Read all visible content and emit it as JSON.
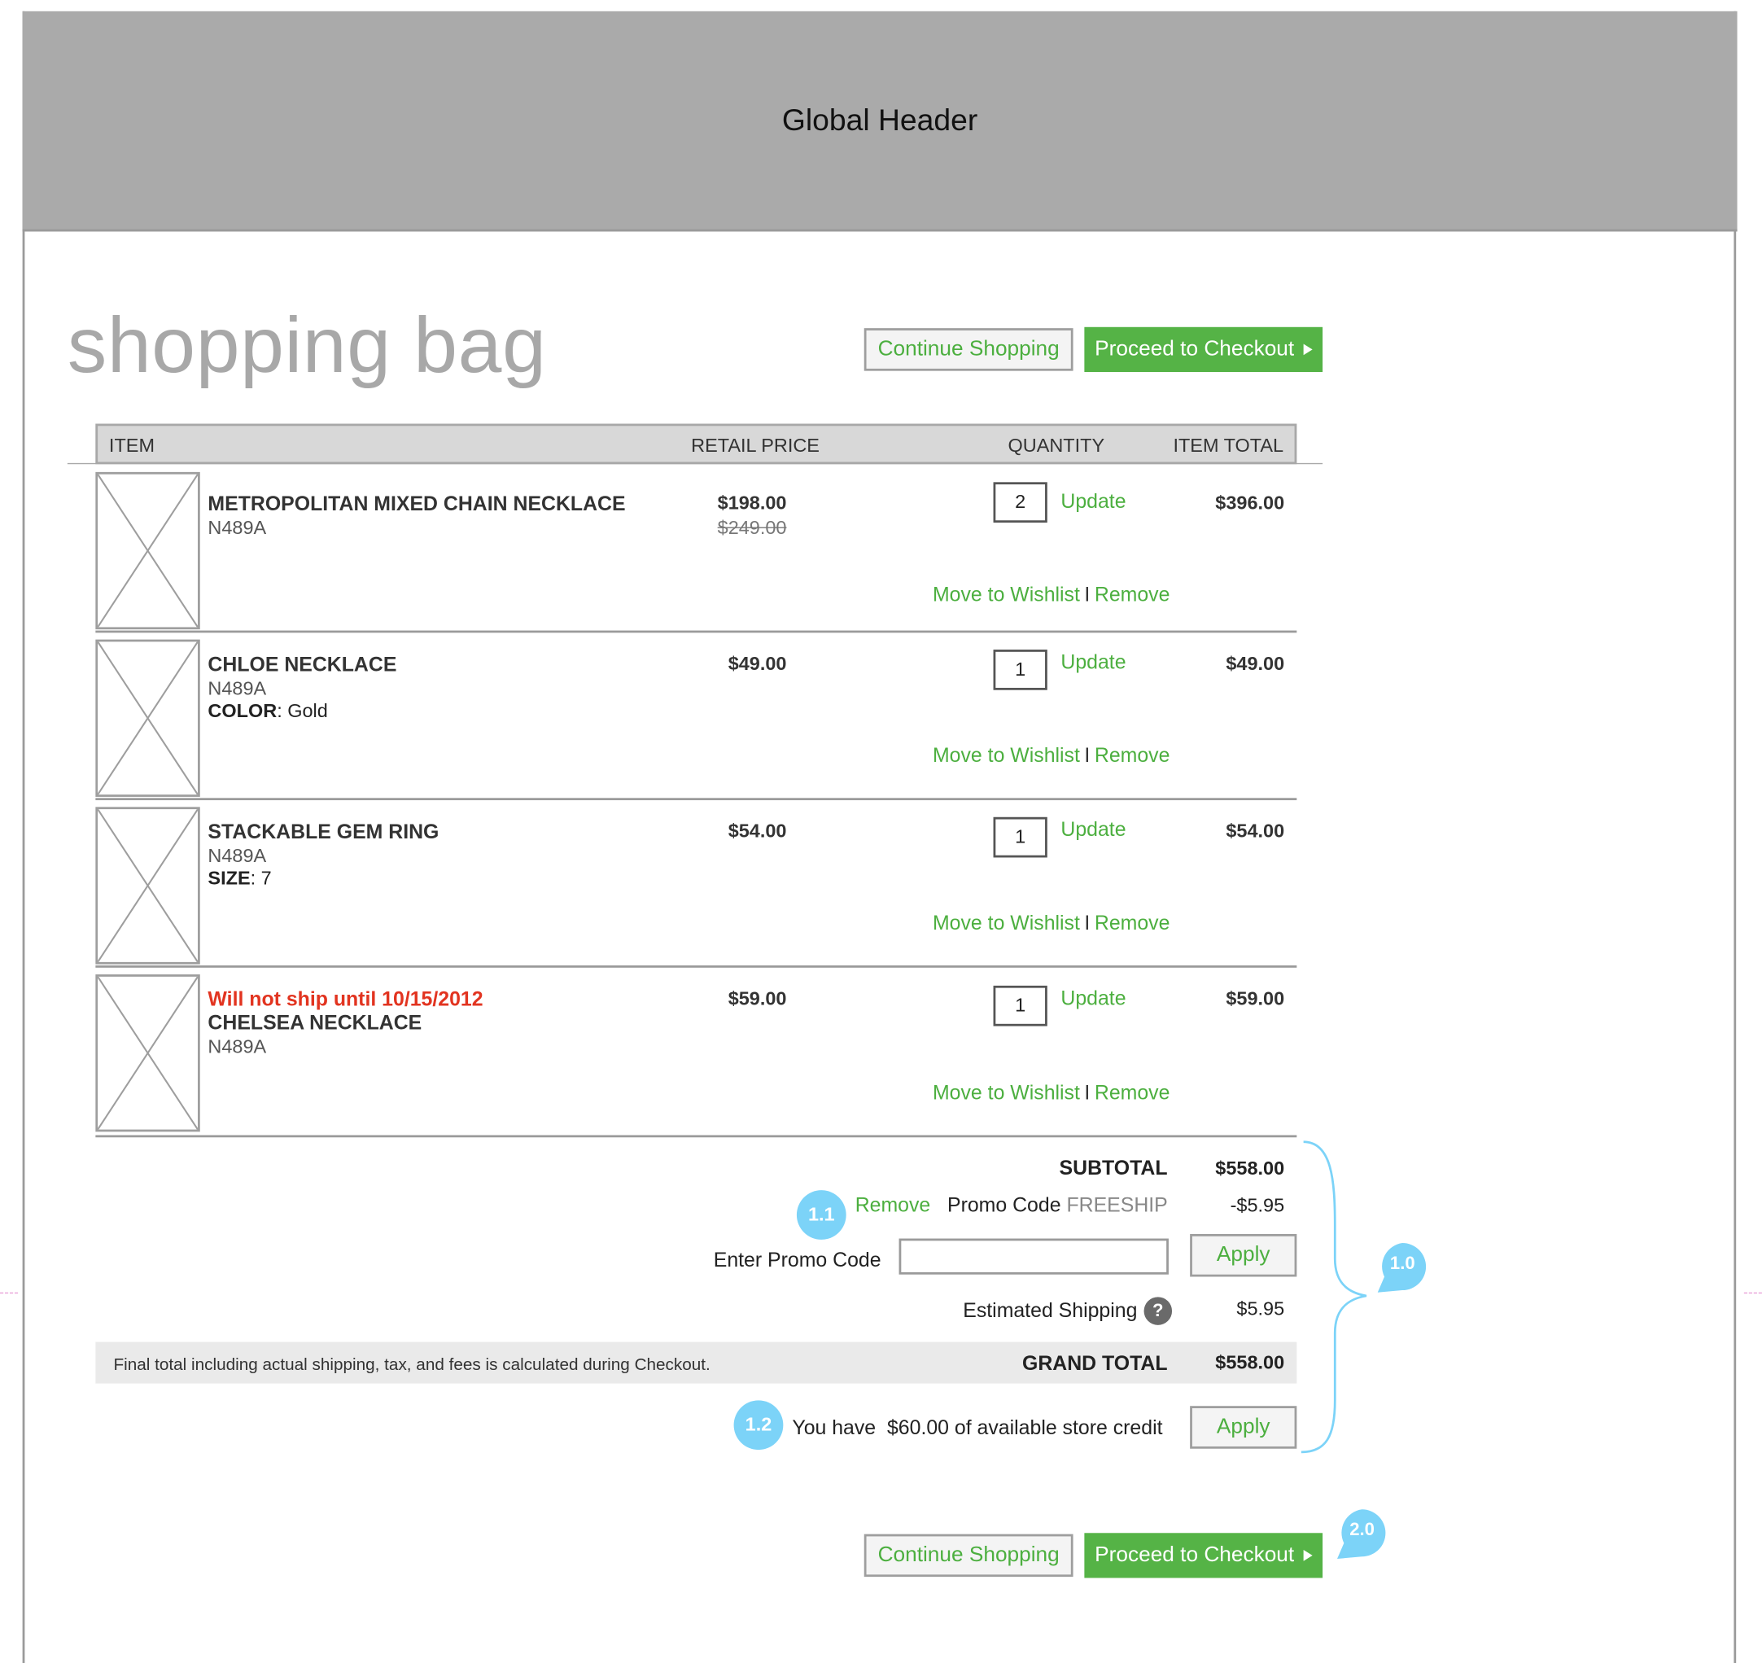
{
  "header": {
    "title": "Global Header"
  },
  "page": {
    "title": "shopping bag"
  },
  "actions": {
    "continue_label": "Continue Shopping",
    "checkout_label": "Proceed to Checkout"
  },
  "table": {
    "columns": {
      "item": "ITEM",
      "price": "RETAIL PRICE",
      "quantity": "QUANTITY",
      "total": "ITEM TOTAL"
    },
    "update_label": "Update",
    "wishlist_label": "Move to Wishlist",
    "separator": "I",
    "remove_label": "Remove",
    "items": [
      {
        "name": "METROPOLITAN MIXED CHAIN NECKLACE",
        "sku": "N489A",
        "price": "$198.00",
        "old_price": "$249.00",
        "qty": "2",
        "total": "$396.00"
      },
      {
        "name": "CHLOE NECKLACE",
        "sku": "N489A",
        "attr_label": "COLOR",
        "attr_value": ": Gold",
        "price": "$49.00",
        "qty": "1",
        "total": "$49.00"
      },
      {
        "name": "STACKABLE GEM RING",
        "sku": "N489A",
        "attr_label": "SIZE",
        "attr_value": ": 7",
        "price": "$54.00",
        "qty": "1",
        "total": "$54.00"
      },
      {
        "warning": "Will not ship until 10/15/2012",
        "name": "CHELSEA NECKLACE",
        "sku": "N489A",
        "price": "$59.00",
        "qty": "1",
        "total": "$59.00"
      }
    ]
  },
  "summary": {
    "subtotal_label": "SUBTOTAL",
    "subtotal_value": "$558.00",
    "promo_remove": "Remove",
    "promo_label": "Promo Code",
    "promo_code": "FREESHIP",
    "promo_value": "-$5.95",
    "enter_promo_label": "Enter Promo Code",
    "promo_input_value": "",
    "apply_label": "Apply",
    "shipping_label": "Estimated Shipping",
    "shipping_value": "$5.95",
    "help_glyph": "?",
    "final_note": "Final total including actual shipping, tax, and fees is calculated during Checkout.",
    "grand_total_label": "GRAND TOTAL",
    "grand_total_value": "$558.00",
    "credit_prefix": "You have",
    "credit_amount": "$60.00",
    "credit_suffix": "of available store credit"
  },
  "annotations": {
    "a1_0": "1.0",
    "a1_1": "1.1",
    "a1_2": "1.2",
    "a2_0": "2.0"
  },
  "colors": {
    "accent_green": "#55b346",
    "link_green": "#4caf3f",
    "annotation_blue": "#7cd3f8",
    "warning_red": "#e23420",
    "header_grey": "#aaaaaa"
  },
  "icons": {
    "checkout_arrow": "triangle-right-icon",
    "help": "question-circle-icon",
    "product_image": "image-placeholder-icon"
  }
}
